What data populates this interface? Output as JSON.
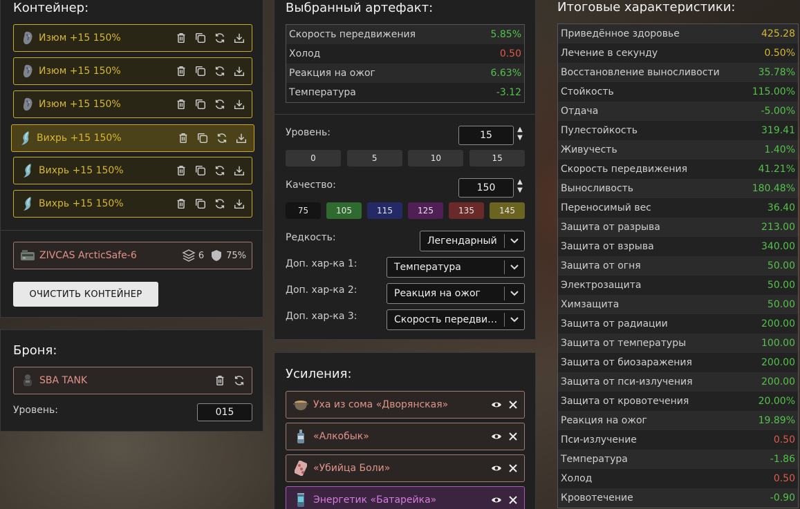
{
  "container": {
    "title": "Контейнер:",
    "artifacts": [
      {
        "name": "Изюм +15 150%",
        "icon": "raisin-artifact-icon",
        "active": false
      },
      {
        "name": "Изюм +15 150%",
        "icon": "raisin-artifact-icon",
        "active": false
      },
      {
        "name": "Изюм +15 150%",
        "icon": "raisin-artifact-icon",
        "active": false
      },
      {
        "name": "Вихрь +15 150%",
        "icon": "whirl-artifact-icon",
        "active": true
      },
      {
        "name": "Вихрь +15 150%",
        "icon": "whirl-artifact-icon",
        "active": false
      },
      {
        "name": "Вихрь +15 150%",
        "icon": "whirl-artifact-icon",
        "active": false
      }
    ],
    "box": {
      "name": "ZIVCAS ArcticSafe-6",
      "slots": "6",
      "protection": "75%"
    },
    "clear_button": "ОЧИСТИТЬ КОНТЕЙНЕР"
  },
  "armor": {
    "title": "Броня:",
    "name": "SBA TANK",
    "level_label": "Уровень:",
    "level_value": "015"
  },
  "artifact": {
    "title": "Выбранный артефакт:",
    "stats": [
      {
        "name": "Скорость передвижения",
        "value": "5.85%",
        "tone": "pos"
      },
      {
        "name": "Холод",
        "value": "0.50",
        "tone": "neg"
      },
      {
        "name": "Реакция на ожог",
        "value": "6.63%",
        "tone": "pos"
      },
      {
        "name": "Температура",
        "value": "-3.12",
        "tone": "pos"
      }
    ],
    "level_label": "Уровень:",
    "level_value": "15",
    "level_presets": [
      "0",
      "5",
      "10",
      "15"
    ],
    "quality_label": "Качество:",
    "quality_value": "150",
    "quality_presets": [
      {
        "label": "75",
        "color": "#141414"
      },
      {
        "label": "105",
        "color": "#2f6b2f"
      },
      {
        "label": "115",
        "color": "#232a66"
      },
      {
        "label": "125",
        "color": "#4f1f55"
      },
      {
        "label": "135",
        "color": "#6b2a2a"
      },
      {
        "label": "145",
        "color": "#6b6420"
      }
    ],
    "rarity_label": "Редкость:",
    "rarity_value": "Легендарный",
    "extra1_label": "Доп. хар-ка 1:",
    "extra1_value": "Температура",
    "extra2_label": "Доп. хар-ка 2:",
    "extra2_value": "Реакция на ожог",
    "extra3_label": "Доп. хар-ка 3:",
    "extra3_value": "Скорость передвижения"
  },
  "boosts": {
    "title": "Усиления:",
    "items": [
      {
        "name": "Уха из сома «Дворянская»",
        "purple": false,
        "icon": "soup-pot-icon"
      },
      {
        "name": "«Алкобык»",
        "purple": false,
        "icon": "bottle-icon"
      },
      {
        "name": "«Убийца Боли»",
        "purple": false,
        "icon": "pill-blister-icon"
      },
      {
        "name": "Энергетик «Батарейка»",
        "purple": true,
        "icon": "energy-can-icon"
      }
    ]
  },
  "totals": {
    "title": "Итоговые характеристики:",
    "rows": [
      {
        "name": "Приведённое здоровье",
        "value": "425.28",
        "tone": "gold"
      },
      {
        "name": "Лечение в секунду",
        "value": "0.50%",
        "tone": "gold"
      },
      {
        "name": "Восстановление выносливости",
        "value": "35.78%",
        "tone": "pos"
      },
      {
        "name": "Стойкость",
        "value": "115.00%",
        "tone": "pos"
      },
      {
        "name": "Отдача",
        "value": "-5.00%",
        "tone": "pos"
      },
      {
        "name": "Пулестойкость",
        "value": "319.41",
        "tone": "pos"
      },
      {
        "name": "Живучесть",
        "value": "1.40%",
        "tone": "pos"
      },
      {
        "name": "Скорость передвижения",
        "value": "41.21%",
        "tone": "pos"
      },
      {
        "name": "Выносливость",
        "value": "180.48%",
        "tone": "pos"
      },
      {
        "name": "Переносимый вес",
        "value": "36.40",
        "tone": "pos"
      },
      {
        "name": "Защита от разрыва",
        "value": "213.00",
        "tone": "pos"
      },
      {
        "name": "Защита от взрыва",
        "value": "340.00",
        "tone": "pos"
      },
      {
        "name": "Защита от огня",
        "value": "50.00",
        "tone": "pos"
      },
      {
        "name": "Электрозащита",
        "value": "50.00",
        "tone": "pos"
      },
      {
        "name": "Химзащита",
        "value": "50.00",
        "tone": "pos"
      },
      {
        "name": "Защита от радиации",
        "value": "200.00",
        "tone": "pos"
      },
      {
        "name": "Защита от температуры",
        "value": "100.00",
        "tone": "pos"
      },
      {
        "name": "Защита от биозаражения",
        "value": "200.00",
        "tone": "pos"
      },
      {
        "name": "Защита от пси-излучения",
        "value": "200.00",
        "tone": "pos"
      },
      {
        "name": "Защита от кровотечения",
        "value": "20.00%",
        "tone": "pos"
      },
      {
        "name": "Реакция на ожог",
        "value": "19.89%",
        "tone": "pos"
      },
      {
        "name": "Пси-излучение",
        "value": "0.50",
        "tone": "neg"
      },
      {
        "name": "Температура",
        "value": "-1.86",
        "tone": "pos"
      },
      {
        "name": "Холод",
        "value": "0.50",
        "tone": "neg"
      },
      {
        "name": "Кровотечение",
        "value": "-0.90",
        "tone": "pos"
      }
    ]
  }
}
